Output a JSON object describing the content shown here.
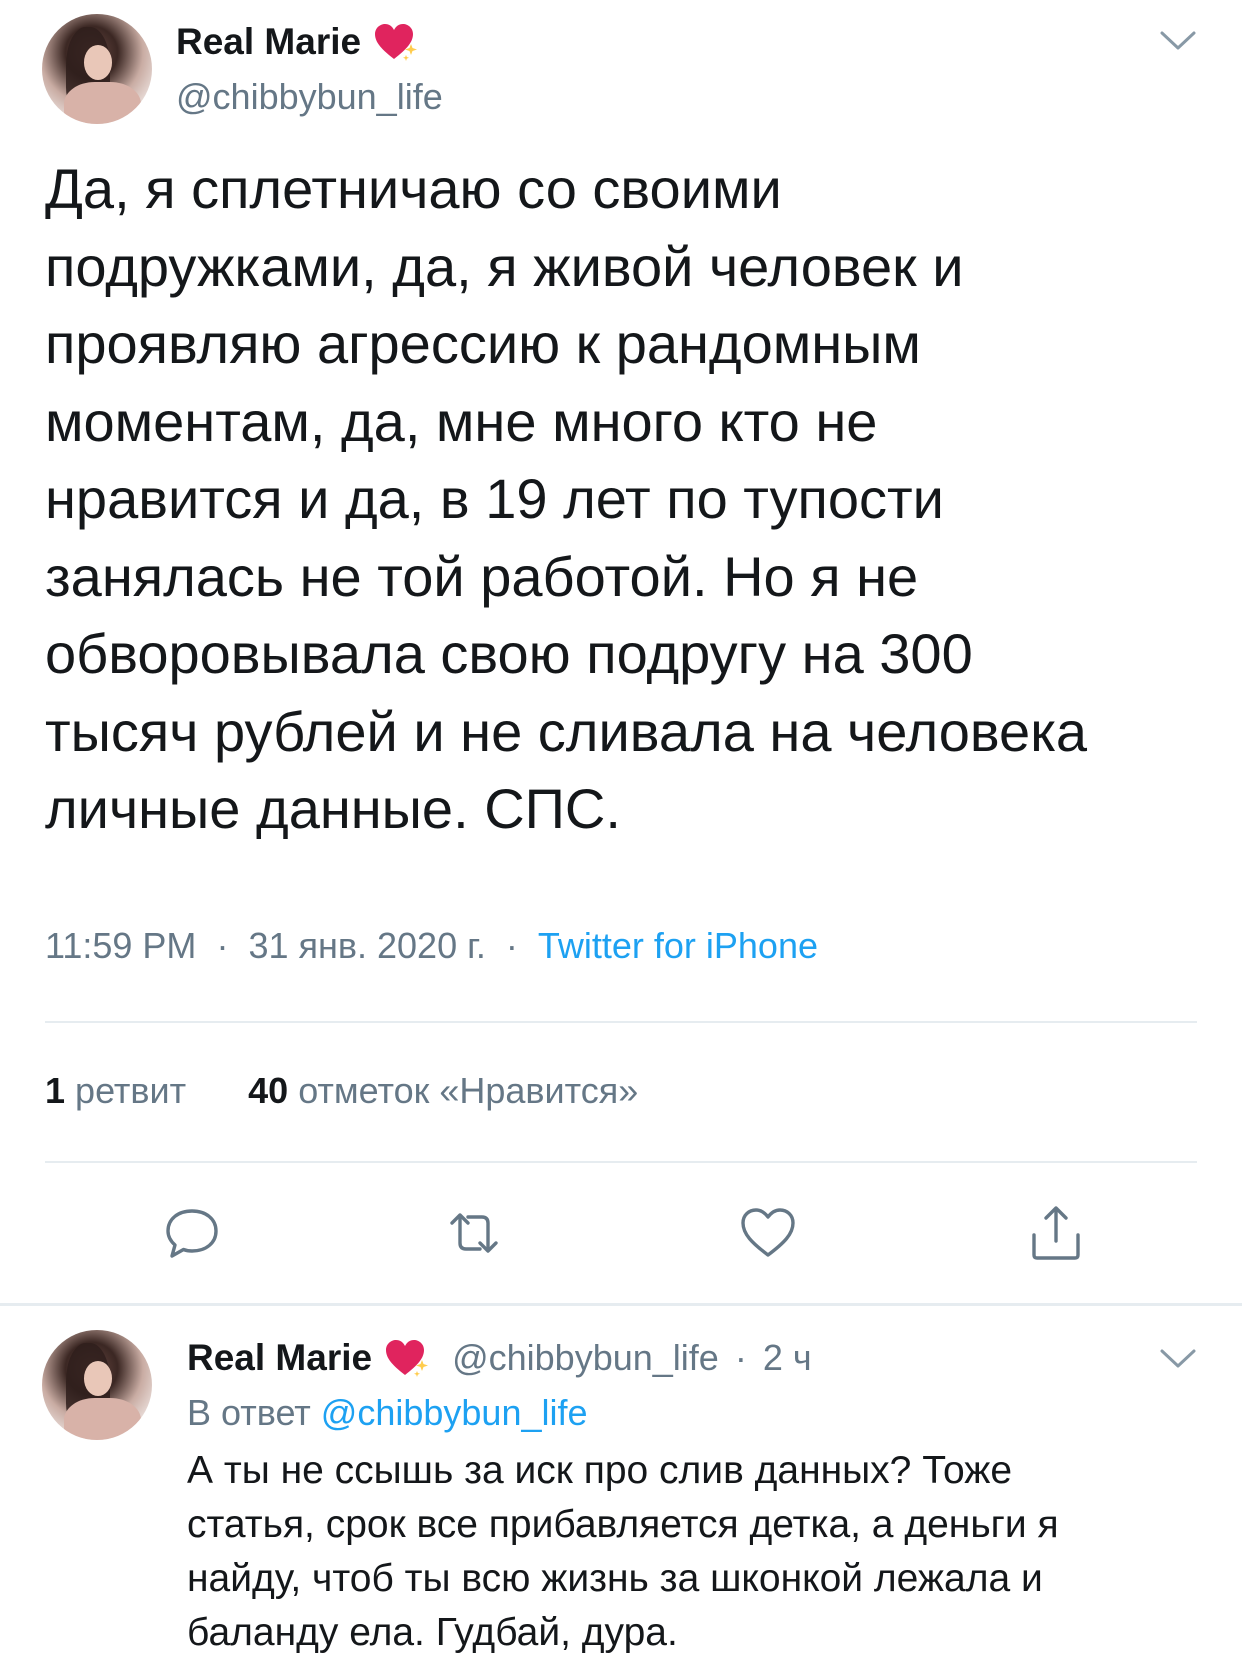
{
  "main_tweet": {
    "author": {
      "display_name": "Real Marie",
      "badge_emoji": "💖",
      "handle": "@chibbybun_life"
    },
    "text_lines": [
      "Да, я сплетничаю со своими",
      "подружками, да, я живой человек и",
      "проявляю агрессию к рандомным",
      "моментам, да, мне много кто не",
      "нравится и да, в 19 лет по тупости",
      "занялась не той работой. Но я не",
      "обворовывала свою подругу на 300",
      "тысяч рублей и не сливала на человека",
      "личные данные. СПС."
    ],
    "time": "11:59 PM",
    "date": "31 янв. 2020 г.",
    "separator": "·",
    "source": "Twitter for iPhone",
    "retweets_count": "1",
    "retweets_label": "ретвит",
    "likes_count": "40",
    "likes_label": "отметок «Нравится»",
    "actions": [
      "reply-icon",
      "retweet-icon",
      "like-icon",
      "share-icon"
    ]
  },
  "reply_tweet": {
    "author": {
      "display_name": "Real Marie",
      "badge_emoji": "💖",
      "handle": "@chibbybun_life"
    },
    "separator": "·",
    "age": "2 ч",
    "reply_prefix": "В ответ",
    "reply_mention": "@chibbybun_life",
    "text_lines": [
      "А ты не ссышь за иск про слив данных? Тоже",
      "статья, срок все прибавляется детка, а деньги я",
      "найду, чтоб ты всю жизнь за шконкой лежала и",
      "баланду ела. Гудбай, дура."
    ]
  },
  "colors": {
    "text_primary": "#14171a",
    "text_secondary": "#657786",
    "link": "#1da1f2",
    "divider": "#e6ecf0",
    "heart_badge": "#e0245e"
  }
}
